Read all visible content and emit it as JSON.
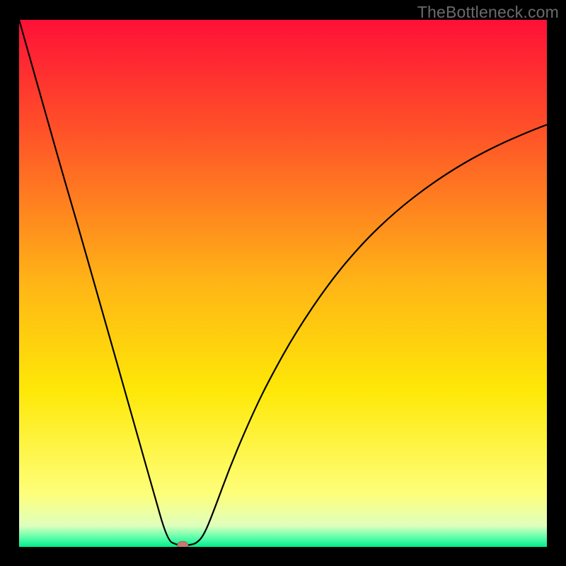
{
  "watermark": "TheBottleneck.com",
  "colors": {
    "bg": "#000000",
    "curve": "#000000",
    "marker_fill": "#c27b6f",
    "marker_stroke": "#a8604f"
  },
  "chart_data": {
    "type": "line",
    "title": "",
    "xlabel": "",
    "ylabel": "",
    "xlim": [
      0,
      100
    ],
    "ylim": [
      0,
      100
    ],
    "gradient_stops": [
      {
        "y": 100.0,
        "color": "#ff1037"
      },
      {
        "y": 78.5,
        "color": "#ff5328"
      },
      {
        "y": 50.0,
        "color": "#ffb516"
      },
      {
        "y": 29.6,
        "color": "#fee807"
      },
      {
        "y": 10.1,
        "color": "#feff7a"
      },
      {
        "y": 4.0,
        "color": "#dfffbd"
      },
      {
        "y": 2.0,
        "color": "#69ffad"
      },
      {
        "y": 0.0,
        "color": "#00ee8e"
      }
    ],
    "curve": {
      "x": [
        0,
        2.8,
        5.6,
        8.4,
        11.3,
        14.1,
        16.9,
        19.7,
        22.5,
        25.3,
        28.1,
        29.9,
        30.7,
        31.6,
        32.5,
        33.6,
        35.0,
        36.8,
        40.3,
        44.4,
        47.6,
        52.4,
        58.8,
        65.1,
        71.4,
        77.7,
        84.0,
        90.4,
        96.6,
        100.0
      ],
      "y": [
        100,
        90.1,
        80.2,
        70.3,
        60.4,
        50.5,
        40.7,
        30.8,
        20.9,
        11.0,
        1.2,
        0.4,
        0.3,
        0.3,
        0.4,
        0.7,
        2.2,
        6.6,
        16.1,
        25.6,
        32.1,
        40.7,
        50.2,
        57.7,
        63.7,
        68.6,
        72.7,
        76.1,
        78.8,
        80.1
      ]
    },
    "marker": {
      "x": 31.0,
      "y": 0.3
    }
  }
}
